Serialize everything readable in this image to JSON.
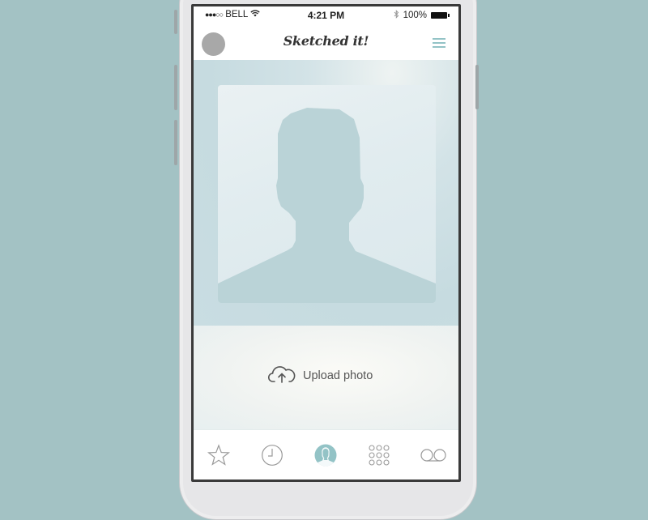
{
  "status_bar": {
    "signal_dots": "●●●○○",
    "carrier": "BELL",
    "wifi_icon": "wifi-icon",
    "time": "4:21 PM",
    "bluetooth_icon": "bluetooth-icon",
    "battery_percent": "100%",
    "battery_level": 1.0
  },
  "nav_bar": {
    "title": "Sketched it!",
    "avatar_icon": "user-avatar",
    "menu_icon": "hamburger-menu-icon"
  },
  "profile": {
    "placeholder_icon": "person-silhouette-placeholder"
  },
  "upload": {
    "label": "Upload photo",
    "icon": "cloud-upload-icon"
  },
  "tab_bar": {
    "tabs": [
      {
        "name": "favorites",
        "icon": "star-icon",
        "active": false
      },
      {
        "name": "recents",
        "icon": "clock-icon",
        "active": false
      },
      {
        "name": "contacts",
        "icon": "contact-icon",
        "active": true
      },
      {
        "name": "keypad",
        "icon": "keypad-icon",
        "active": false
      },
      {
        "name": "voicemail",
        "icon": "voicemail-icon",
        "active": false
      }
    ]
  },
  "colors": {
    "background": "#a3c2c4",
    "accent": "#93c3c6",
    "silhouette": "#b9d3d6"
  }
}
